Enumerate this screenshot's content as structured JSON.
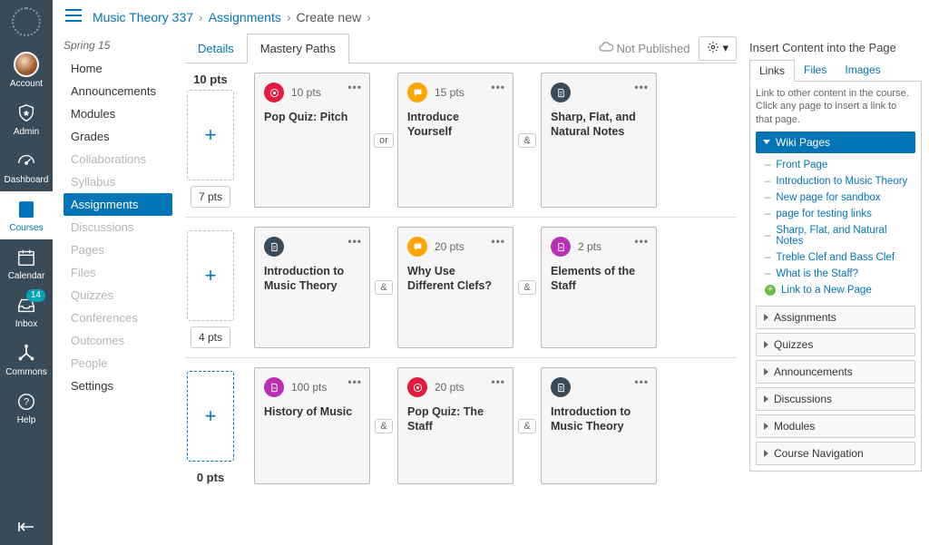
{
  "globalNav": {
    "account": "Account",
    "admin": "Admin",
    "dashboard": "Dashboard",
    "courses": "Courses",
    "calendar": "Calendar",
    "inbox": "Inbox",
    "inboxBadge": "14",
    "commons": "Commons",
    "help": "Help"
  },
  "breadcrumb": {
    "course": "Music Theory 337",
    "section": "Assignments",
    "page": "Create new"
  },
  "courseNav": {
    "term": "Spring 15",
    "items": [
      {
        "label": "Home",
        "dim": false
      },
      {
        "label": "Announcements",
        "dim": false
      },
      {
        "label": "Modules",
        "dim": false
      },
      {
        "label": "Grades",
        "dim": false
      },
      {
        "label": "Collaborations",
        "dim": true
      },
      {
        "label": "Syllabus",
        "dim": true
      },
      {
        "label": "Assignments",
        "dim": false,
        "active": true
      },
      {
        "label": "Discussions",
        "dim": true
      },
      {
        "label": "Pages",
        "dim": true
      },
      {
        "label": "Files",
        "dim": true
      },
      {
        "label": "Quizzes",
        "dim": true
      },
      {
        "label": "Conferences",
        "dim": true
      },
      {
        "label": "Outcomes",
        "dim": true
      },
      {
        "label": "People",
        "dim": true
      },
      {
        "label": "Settings",
        "dim": false
      }
    ]
  },
  "tabs": {
    "details": "Details",
    "mastery": "Mastery Paths"
  },
  "status": {
    "notPublished": "Not Published"
  },
  "rows": [
    {
      "top": "10 pts",
      "bottom": "7 pts",
      "cards": [
        {
          "type": "quiz",
          "pts": "10 pts",
          "title": "Pop Quiz: Pitch"
        },
        {
          "conn": "or"
        },
        {
          "type": "disc",
          "pts": "15 pts",
          "title": "Introduce Yourself"
        },
        {
          "conn": "&"
        },
        {
          "type": "page",
          "pts": "",
          "title": "Sharp, Flat, and Natural Notes"
        }
      ]
    },
    {
      "top": "",
      "bottom": "4 pts",
      "cards": [
        {
          "type": "page",
          "pts": "",
          "title": "Introduction to Music Theory"
        },
        {
          "conn": "&"
        },
        {
          "type": "disc",
          "pts": "20 pts",
          "title": "Why Use Different Clefs?"
        },
        {
          "conn": "&"
        },
        {
          "type": "assn",
          "pts": "2 pts",
          "title": "Elements of the Staff"
        }
      ]
    },
    {
      "top": "",
      "bottom": "0 pts",
      "active": true,
      "cards": [
        {
          "type": "assn",
          "pts": "100 pts",
          "title": "History of Music"
        },
        {
          "conn": "&"
        },
        {
          "type": "quiz",
          "pts": "20 pts",
          "title": "Pop Quiz: The Staff"
        },
        {
          "conn": "&"
        },
        {
          "type": "page",
          "pts": "",
          "title": "Introduction to Music Theory"
        }
      ]
    }
  ],
  "rail": {
    "heading": "Insert Content into the Page",
    "tabs": {
      "links": "Links",
      "files": "Files",
      "images": "Images"
    },
    "hint": "Link to other content in the course. Click any page to insert a link to that page.",
    "wikiHeader": "Wiki Pages",
    "wikiPages": [
      "Front Page",
      "Introduction to Music Theory",
      "New page for sandbox",
      "page for testing links",
      "Sharp, Flat, and Natural Notes",
      "Treble Clef and Bass Clef",
      "What is the Staff?"
    ],
    "newPage": "Link to a New Page",
    "accordions": [
      "Assignments",
      "Quizzes",
      "Announcements",
      "Discussions",
      "Modules",
      "Course Navigation"
    ]
  }
}
